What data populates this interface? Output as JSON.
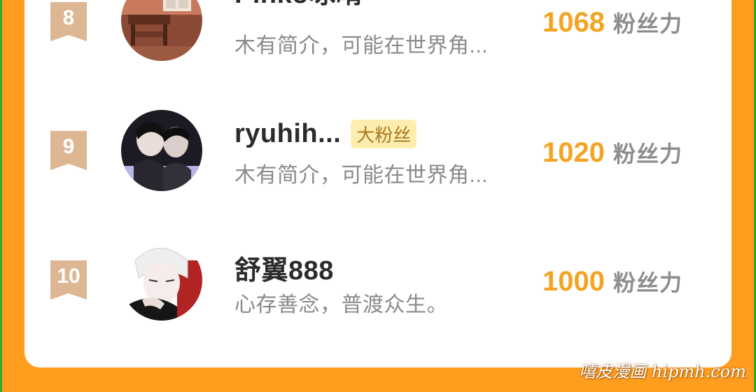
{
  "rankings": [
    {
      "rank": "8",
      "name": "Pinko咏晴",
      "tag": "",
      "bio": "木有简介，可能在世界角...",
      "score": "1068",
      "score_unit": "粉丝力",
      "avatar_icon": "room-photo-avatar"
    },
    {
      "rank": "9",
      "name": "ryuhih...",
      "tag": "大粉丝",
      "bio": "木有简介，可能在世界角...",
      "score": "1020",
      "score_unit": "粉丝力",
      "avatar_icon": "couple-photo-avatar"
    },
    {
      "rank": "10",
      "name": "舒翼888",
      "tag": "",
      "bio": "心存善念，普渡众生。",
      "score": "1000",
      "score_unit": "粉丝力",
      "avatar_icon": "anime-character-avatar"
    }
  ],
  "watermark": "嘻皮漫画 hipmh.com",
  "colors": {
    "background": "#ff9d1f",
    "score": "#f4a423",
    "badge": "#ddb694",
    "tag_bg": "#fdeeb0"
  }
}
